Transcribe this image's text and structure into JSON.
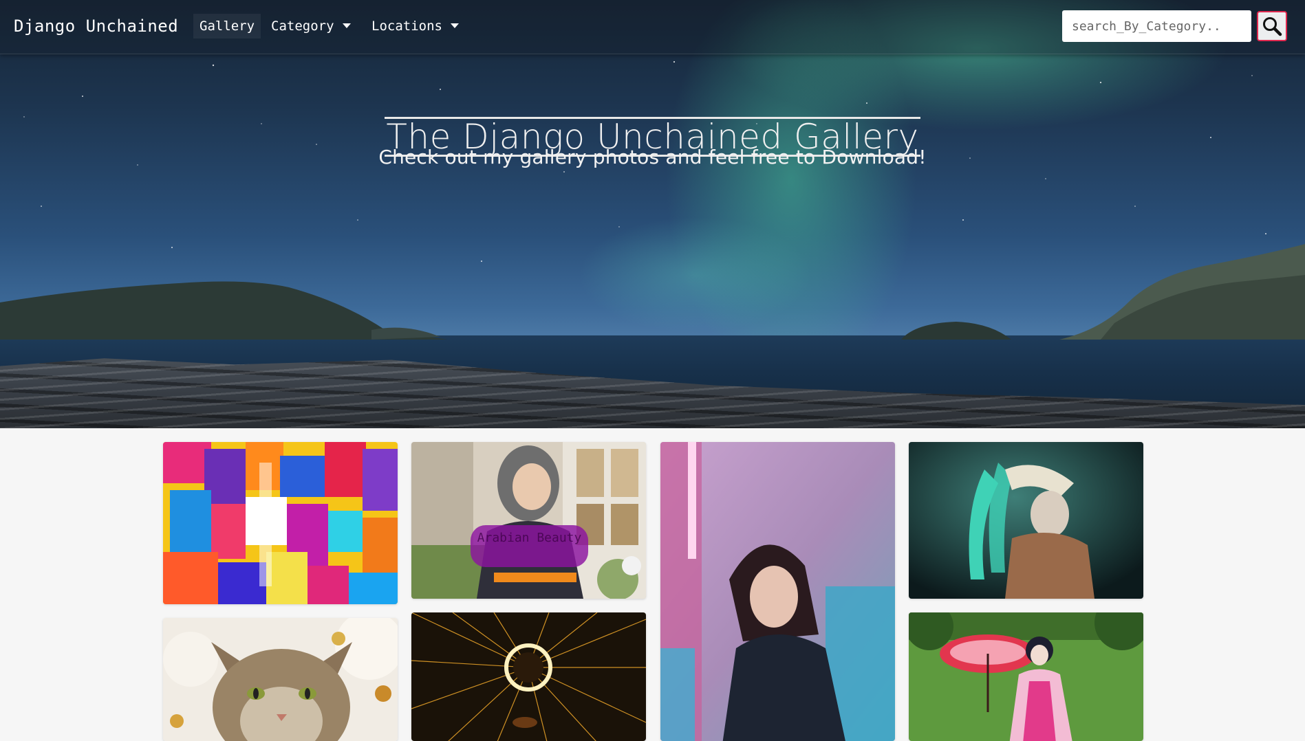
{
  "navbar": {
    "brand": "Django Unchained",
    "links": [
      {
        "label": "Gallery",
        "dropdown": false
      },
      {
        "label": "Category",
        "dropdown": true
      },
      {
        "label": "Locations",
        "dropdown": true
      }
    ],
    "search_placeholder": "search_By_Category..",
    "search_button_icon": "search-icon",
    "search_button_border_color": "#e0284f"
  },
  "hero": {
    "title": "The Django Unchained Gallery",
    "subtitle": "Check out my gallery photos and feel free to Download!"
  },
  "gallery": {
    "images": [
      {
        "name": "abstract-paint-photo"
      },
      {
        "name": "hijab-woman-photo",
        "caption": "Arabian Beauty"
      },
      {
        "name": "neon-girl-photo"
      },
      {
        "name": "headdress-man-photo"
      },
      {
        "name": "cat-photo"
      },
      {
        "name": "steel-wool-photo"
      },
      {
        "name": "umbrella-girl-photo"
      }
    ]
  },
  "colors": {
    "caption_badge": "#8c14a0",
    "page_background": "#f6f6f6"
  }
}
